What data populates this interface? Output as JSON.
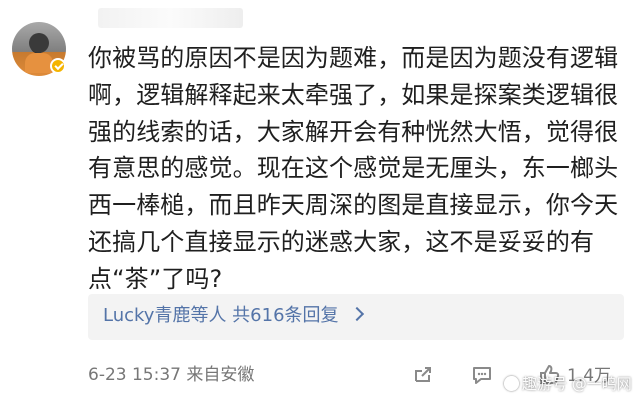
{
  "comment": {
    "text": "你被骂的原因不是因为题难，而是因为题没有逻辑啊，逻辑解释起来太牵强了，如果是探案类逻辑很强的线索的话，大家解开会有种恍然大悟，觉得很有意思的感觉。现在这个感觉是无厘头，东一榔头西一棒槌，而且昨天周深的图是直接显示，你今天还搞几个直接显示的迷惑大家，这不是妥妥的有点“茶”了吗?"
  },
  "replies": {
    "link_text": "Lucky青鹿等人   共616条回复"
  },
  "meta": {
    "timestamp_source": "6-23 15:37  来自安徽",
    "like_count": "1.4万"
  },
  "watermark": {
    "text": "趣游号 @一鸣网"
  },
  "icons": {
    "avatar": "user-avatar",
    "verified": "verified-badge-icon",
    "reply_chevron": "chevron-right-icon",
    "share": "share-icon",
    "comment": "comment-icon",
    "like": "thumbs-up-icon",
    "watermark": "watermark-logo-icon"
  },
  "colors": {
    "background": "#ffffff",
    "text": "#1f1f1f",
    "reply_link": "#5474a8",
    "reply_box": "#f3f3f3",
    "meta": "#777777",
    "badge": "#f4b400"
  }
}
